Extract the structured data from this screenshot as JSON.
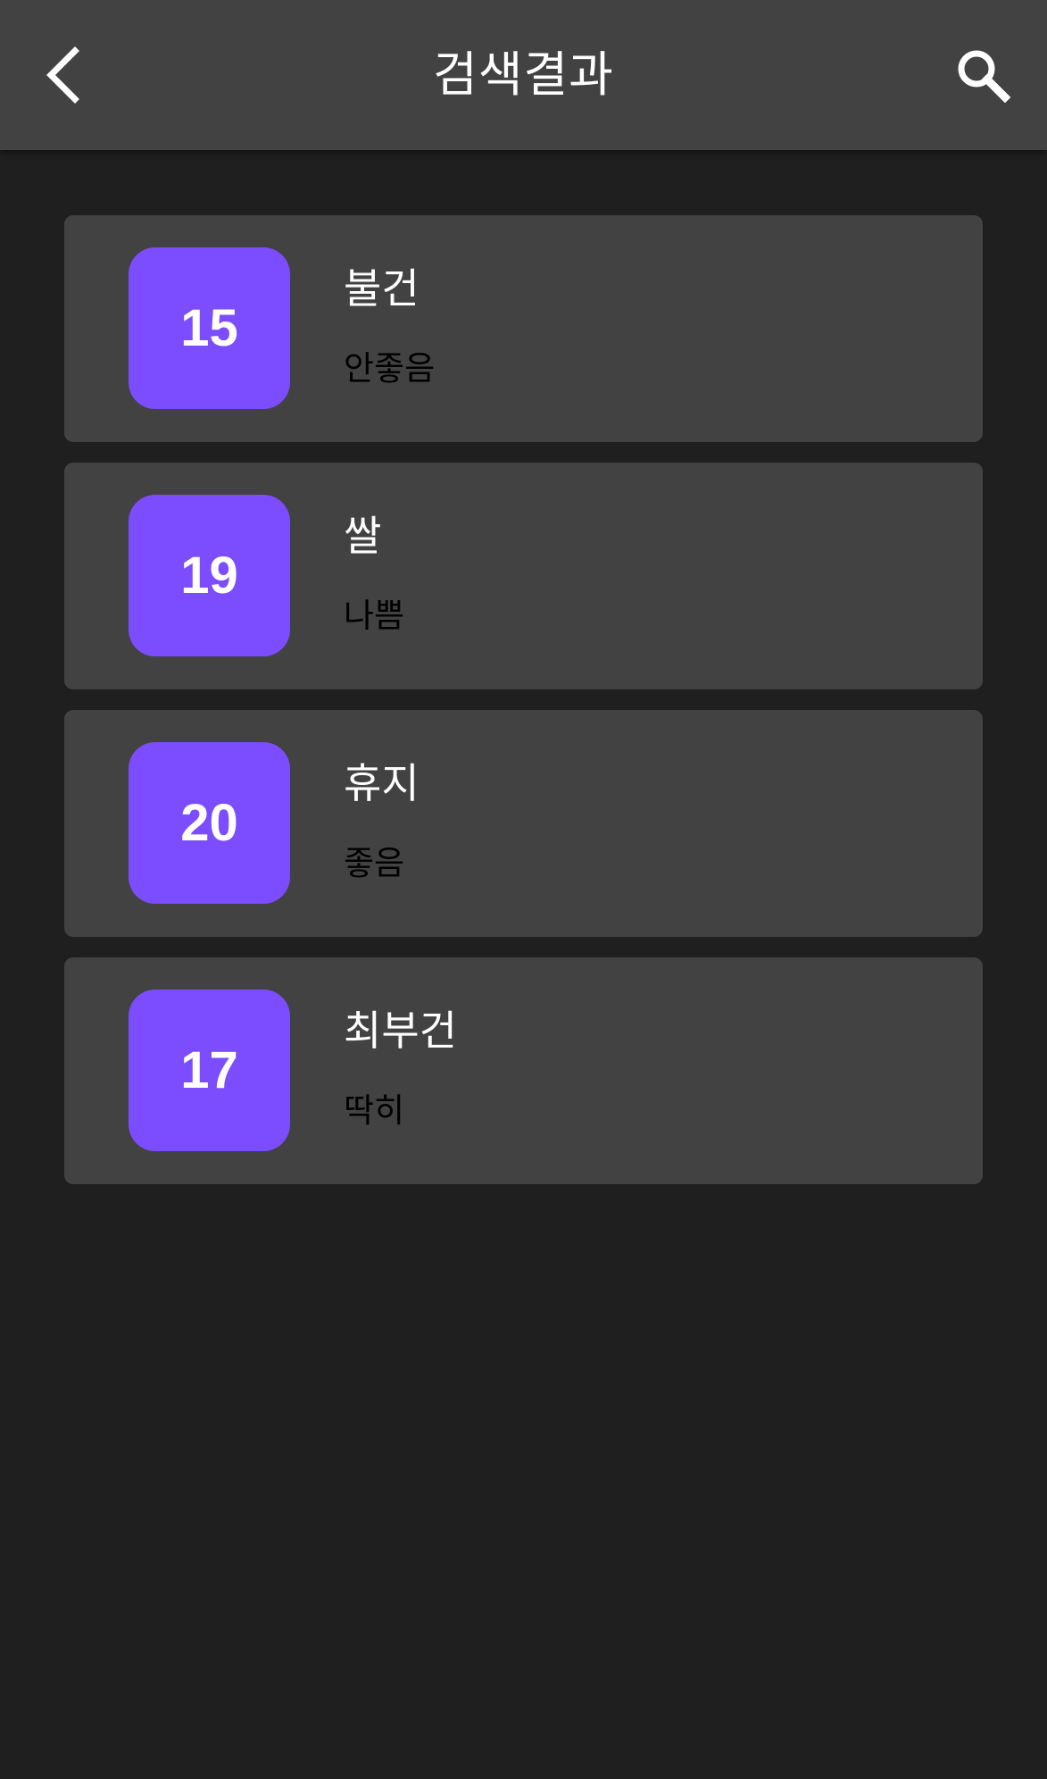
{
  "header": {
    "title": "검색결과",
    "back_icon": "chevron-left-icon",
    "search_icon": "search-icon"
  },
  "colors": {
    "header_bg": "#424242",
    "page_bg": "#1f1f1f",
    "card_bg": "#424242",
    "badge_bg": "#7c4dff",
    "title_text": "#ffffff",
    "status_text": "#000000"
  },
  "results": [
    {
      "number": "15",
      "name": "불건",
      "status": "안좋음"
    },
    {
      "number": "19",
      "name": "쌀",
      "status": "나쁨"
    },
    {
      "number": "20",
      "name": "휴지",
      "status": "좋음"
    },
    {
      "number": "17",
      "name": "최부건",
      "status": "딱히"
    }
  ]
}
